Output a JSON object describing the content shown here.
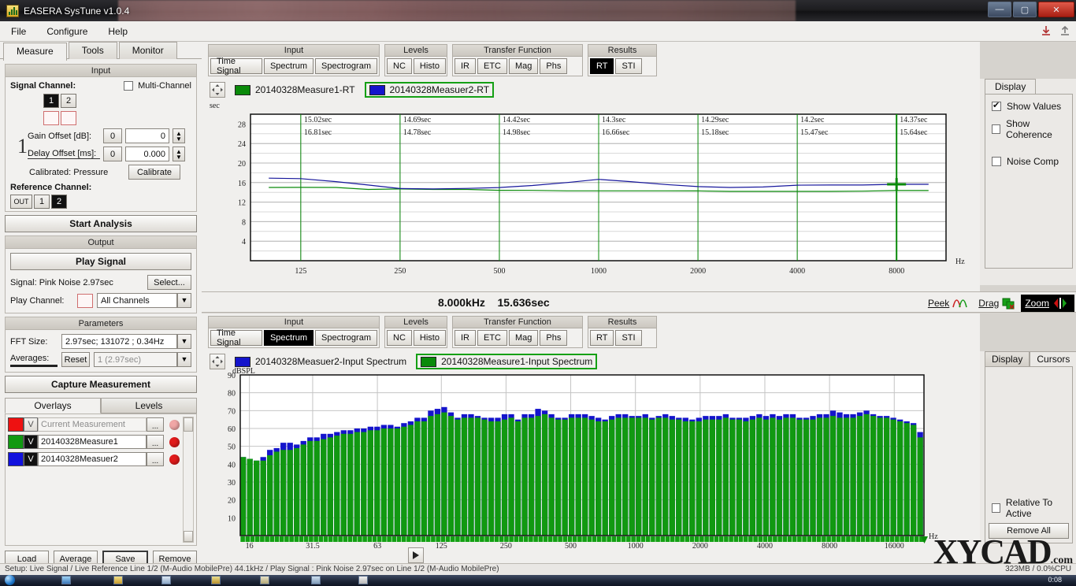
{
  "window": {
    "title": "EASERA SysTune v1.0.4",
    "minimize": "—",
    "maximize": "▢",
    "close": "✕"
  },
  "menu": {
    "items": [
      "File",
      "Configure",
      "Help"
    ]
  },
  "left_tabs": [
    {
      "label": "Measure",
      "active": true
    },
    {
      "label": "Tools",
      "active": false
    },
    {
      "label": "Monitor",
      "active": false
    }
  ],
  "input_group": {
    "title": "Input",
    "signal_channel_label": "Signal Channel:",
    "multi_channel_label": "Multi-Channel",
    "multi_channel_checked": false,
    "channels": [
      {
        "label": "1",
        "active": true
      },
      {
        "label": "2",
        "active": false
      }
    ],
    "index_label": "1",
    "gain_offset_label": "Gain Offset [dB]:",
    "gain_offset_btn": "0",
    "gain_offset_value": "0",
    "delay_offset_label": "Delay Offset [ms]:",
    "delay_offset_btn": "0",
    "delay_offset_value": "0.000",
    "calibrated_label": "Calibrated: Pressure",
    "calibrate_button": "Calibrate",
    "reference_channel_label": "Reference Channel:",
    "reference_channels": [
      {
        "label": "OUT",
        "active": false
      },
      {
        "label": "1",
        "active": false
      },
      {
        "label": "2",
        "active": true
      }
    ]
  },
  "start_analysis_button": "Start Analysis",
  "output_group": {
    "title": "Output",
    "play_signal_button": "Play Signal",
    "signal_label": "Signal: Pink Noise  2.97sec",
    "select_button": "Select...",
    "play_channel_label": "Play Channel:",
    "play_channel_value": "All Channels"
  },
  "parameters_group": {
    "title": "Parameters",
    "fft_size_label": "FFT Size:",
    "fft_size_value": "2.97sec; 131072 ; 0.34Hz",
    "averages_label": "Averages:",
    "reset_button": "Reset",
    "averages_value": "1  (2.97sec)"
  },
  "capture_button": "Capture Measurement",
  "overlays": {
    "tabs": [
      {
        "label": "Overlays",
        "active": true
      },
      {
        "label": "Levels",
        "active": false
      }
    ],
    "rows": [
      {
        "color": "#ee1111",
        "visible": "V",
        "name": "Current Measurement",
        "dots": "...",
        "active": false,
        "dim": true
      },
      {
        "color": "#119911",
        "visible": "V",
        "name": "20140328Measure1",
        "dots": "...",
        "active": true,
        "dim": false
      },
      {
        "color": "#1111dd",
        "visible": "V",
        "name": "20140328Measuer2",
        "dots": "...",
        "active": true,
        "dim": false
      }
    ],
    "buttons": [
      "Load",
      "Average",
      "Save",
      "Remove"
    ]
  },
  "top_panel": {
    "toolbar": [
      {
        "title": "Input",
        "buttons": [
          {
            "label": "Time Signal",
            "on": false
          },
          {
            "label": "Spectrum",
            "on": false
          },
          {
            "label": "Spectrogram",
            "on": false
          }
        ]
      },
      {
        "title": "Levels",
        "buttons": [
          {
            "label": "NC",
            "on": false
          },
          {
            "label": "Histo",
            "on": false
          }
        ]
      },
      {
        "title": "Transfer Function",
        "buttons": [
          {
            "label": "IR",
            "on": false
          },
          {
            "label": "ETC",
            "on": false
          },
          {
            "label": "Mag",
            "on": false
          },
          {
            "label": "Phs",
            "on": false
          }
        ]
      },
      {
        "title": "Results",
        "buttons": [
          {
            "label": "RT",
            "on": true
          },
          {
            "label": "STI",
            "on": false
          }
        ]
      }
    ],
    "legend": [
      {
        "color": "#0a8a0a",
        "label": "20140328Measure1-RT",
        "selected": false
      },
      {
        "color": "#1414cc",
        "label": "20140328Measuer2-RT",
        "selected": true
      }
    ]
  },
  "bottom_panel": {
    "toolbar": [
      {
        "title": "Input",
        "buttons": [
          {
            "label": "Time Signal",
            "on": false
          },
          {
            "label": "Spectrum",
            "on": true
          },
          {
            "label": "Spectrogram",
            "on": false
          }
        ]
      },
      {
        "title": "Levels",
        "buttons": [
          {
            "label": "NC",
            "on": false
          },
          {
            "label": "Histo",
            "on": false
          }
        ]
      },
      {
        "title": "Transfer Function",
        "buttons": [
          {
            "label": "IR",
            "on": false
          },
          {
            "label": "ETC",
            "on": false
          },
          {
            "label": "Mag",
            "on": false
          },
          {
            "label": "Phs",
            "on": false
          }
        ]
      },
      {
        "title": "Results",
        "buttons": [
          {
            "label": "RT",
            "on": false
          },
          {
            "label": "STI",
            "on": false
          }
        ]
      }
    ],
    "legend": [
      {
        "color": "#1414cc",
        "label": "20140328Measuer2-Input Spectrum",
        "selected": false
      },
      {
        "color": "#0a8a0a",
        "label": "20140328Measure1-Input Spectrum",
        "selected": true
      }
    ]
  },
  "midbar": {
    "frequency": "8.000kHz",
    "time": "15.636sec",
    "peek_label": "Peek",
    "drag_label": "Drag",
    "zoom_label": "Zoom",
    "zoom_active": true
  },
  "top_right_panel": {
    "tabs": [
      {
        "label": "Display",
        "active": true
      }
    ],
    "checks": [
      {
        "label": "Show Values",
        "checked": true
      },
      {
        "label": "Show Coherence",
        "checked": false
      },
      {
        "label": "Noise Comp",
        "checked": false
      }
    ]
  },
  "bottom_right_panel": {
    "tabs": [
      {
        "label": "Display",
        "active": false
      },
      {
        "label": "Cursors",
        "active": true
      }
    ],
    "relative_label": "Relative To Active",
    "relative_checked": false,
    "remove_all_button": "Remove All"
  },
  "watermark": {
    "text": "XYCAD",
    "suffix": ".com"
  },
  "statusbar": {
    "left": "Setup: Live Signal / Live Reference Line 1/2 (M-Audio MobilePre) 44.1kHz / Play Signal : Pink Noise  2.97sec on Line 1/2 (M-Audio MobilePre)",
    "right": "323MB / 0.0%CPU"
  },
  "taskbar": {
    "clock": "0:08"
  },
  "chart_data": [
    {
      "id": "rt-chart",
      "type": "line",
      "title": "",
      "ylabel": "sec",
      "xlabel": "Hz",
      "ylim": [
        0,
        30
      ],
      "yticks": [
        4,
        8,
        12,
        16,
        20,
        24,
        28
      ],
      "xticks": [
        125,
        250,
        500,
        1000,
        2000,
        4000,
        8000
      ],
      "xlim": [
        88,
        11300
      ],
      "grid": true,
      "value_columns": [
        {
          "x": 125,
          "green": "15.02sec",
          "blue": "16.81sec"
        },
        {
          "x": 250,
          "green": "14.69sec",
          "blue": "14.78sec"
        },
        {
          "x": 500,
          "green": "14.42sec",
          "blue": "14.98sec"
        },
        {
          "x": 1000,
          "green": "14.3sec",
          "blue": "16.66sec"
        },
        {
          "x": 2000,
          "green": "14.29sec",
          "blue": "15.18sec"
        },
        {
          "x": 4000,
          "green": "14.2sec",
          "blue": "15.47sec"
        },
        {
          "x": 8000,
          "green": "14.37sec",
          "blue": "15.64sec"
        }
      ],
      "series": [
        {
          "name": "20140328Measure1-RT",
          "color": "#0a8a0a",
          "x": [
            100,
            125,
            160,
            200,
            250,
            315,
            400,
            500,
            630,
            800,
            1000,
            1250,
            1600,
            2000,
            2500,
            3150,
            4000,
            5000,
            6300,
            8000,
            10000
          ],
          "values": [
            15.0,
            15.02,
            15.0,
            14.6,
            14.69,
            14.6,
            14.6,
            14.42,
            14.4,
            14.3,
            14.3,
            14.3,
            14.3,
            14.29,
            14.2,
            14.2,
            14.2,
            14.2,
            14.25,
            14.37,
            14.37
          ]
        },
        {
          "name": "20140328Measuer2-RT",
          "color": "#17179c",
          "x": [
            100,
            125,
            160,
            200,
            250,
            315,
            400,
            500,
            630,
            800,
            1000,
            1250,
            1600,
            2000,
            2500,
            3150,
            4000,
            5000,
            6300,
            8000,
            10000
          ],
          "values": [
            16.9,
            16.81,
            16.2,
            15.5,
            14.78,
            14.7,
            14.8,
            14.98,
            15.4,
            16.0,
            16.66,
            16.2,
            15.6,
            15.18,
            15.0,
            15.1,
            15.47,
            15.5,
            15.5,
            15.64,
            15.64
          ]
        }
      ],
      "cursor": {
        "x": 8000,
        "y": 15.636,
        "color": "#0a8a0a"
      }
    },
    {
      "id": "spectrum-chart",
      "type": "bar",
      "title": "",
      "ylabel": "dBSPL",
      "xlabel": "Hz",
      "ylim": [
        0,
        90
      ],
      "yticks": [
        10,
        20,
        30,
        40,
        50,
        60,
        70,
        80,
        90
      ],
      "xticks": [
        16,
        31.5,
        63,
        125,
        250,
        500,
        1000,
        2000,
        4000,
        8000,
        16000
      ],
      "xlim": [
        14.5,
        22000
      ],
      "grid": true,
      "series": [
        {
          "name": "20140328Measure1-Input Spectrum",
          "color": "#119911",
          "values": [
            44,
            43,
            42,
            42,
            45,
            47,
            48,
            48,
            49,
            51,
            53,
            53,
            54,
            55,
            56,
            57,
            57,
            58,
            58,
            59,
            59,
            60,
            60,
            60,
            61,
            62,
            64,
            64,
            67,
            68,
            69,
            67,
            65,
            66,
            66,
            66,
            65,
            64,
            64,
            65,
            66,
            64,
            66,
            66,
            67,
            68,
            66,
            65,
            65,
            66,
            66,
            66,
            65,
            64,
            64,
            65,
            66,
            66,
            66,
            66,
            66,
            65,
            66,
            66,
            65,
            65,
            64,
            64,
            64,
            65,
            65,
            65,
            66,
            65,
            65,
            64,
            65,
            66,
            65,
            66,
            65,
            66,
            66,
            65,
            65,
            65,
            66,
            66,
            67,
            66,
            66,
            66,
            67,
            68,
            67,
            66,
            66,
            65,
            64,
            63,
            62,
            55
          ]
        },
        {
          "name": "20140328Measuer2-Input Spectrum",
          "color": "#1414cc",
          "values": [
            44,
            43,
            42,
            44,
            48,
            49,
            52,
            52,
            51,
            53,
            55,
            55,
            57,
            57,
            58,
            59,
            59,
            60,
            60,
            61,
            61,
            62,
            62,
            61,
            63,
            64,
            66,
            66,
            70,
            71,
            72,
            69,
            66,
            68,
            68,
            67,
            66,
            66,
            66,
            68,
            68,
            65,
            68,
            68,
            71,
            70,
            68,
            66,
            66,
            68,
            68,
            68,
            67,
            66,
            65,
            67,
            68,
            68,
            67,
            67,
            68,
            66,
            67,
            68,
            67,
            66,
            66,
            65,
            66,
            67,
            67,
            67,
            68,
            66,
            66,
            66,
            67,
            68,
            67,
            68,
            67,
            68,
            68,
            66,
            66,
            67,
            68,
            68,
            70,
            69,
            68,
            68,
            69,
            70,
            68,
            67,
            67,
            66,
            65,
            64,
            63,
            58
          ]
        }
      ]
    }
  ]
}
